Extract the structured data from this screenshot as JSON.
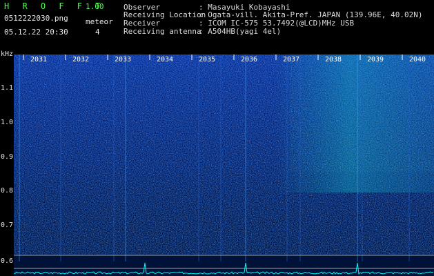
{
  "header": {
    "title": "H R O F F T",
    "version": "1.00",
    "file_name": "0512222030.png",
    "meteor_label": "meteor",
    "timestamp": "05.12.22 20:30",
    "meteor_count": "4"
  },
  "info": [
    {
      "key": "Observer",
      "value": ": Masayuki Kobayashi"
    },
    {
      "key": "Receiving Location",
      "value": ": Ogata-vill. Akita-Pref. JAPAN (139.96E, 40.02N)"
    },
    {
      "key": "Receiver",
      "value": ": ICOM IC-575 53.7492(@LCD)MHz USB"
    },
    {
      "key": "Receiving antenna",
      "value": ": A504HB(yagi 4el)"
    }
  ],
  "spectrogram": {
    "y_unit": "kHz",
    "y_ticks": [
      "1.1",
      "1.0",
      "0.9",
      "0.8",
      "0.7",
      "0.6"
    ],
    "x_ticks": [
      "2031",
      "2032",
      "2033",
      "2034",
      "2035",
      "2036",
      "2037",
      "2038",
      "2039",
      "2040"
    ],
    "colors": {
      "background": "#001238",
      "tick_text": "#ffffff",
      "reference_line": "#a0a0a0",
      "trace": "#00ffff",
      "meteor": "#ffff66"
    }
  }
}
